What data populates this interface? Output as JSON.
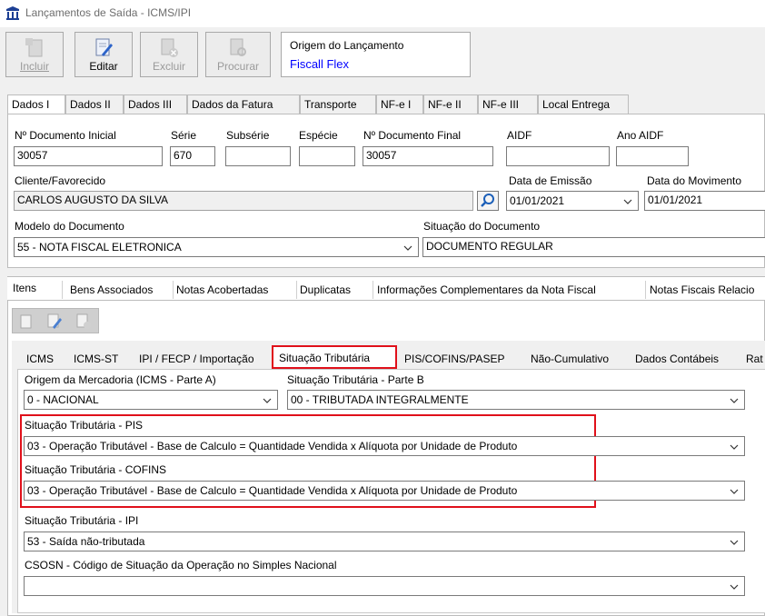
{
  "window": {
    "title": "Lançamentos de Saída - ICMS/IPI"
  },
  "toolbar": {
    "buttons": [
      {
        "label": "Incluir",
        "enabled": false
      },
      {
        "label": "Editar",
        "enabled": true
      },
      {
        "label": "Excluir",
        "enabled": false
      },
      {
        "label": "Procurar",
        "enabled": false
      }
    ],
    "origem_caption": "Origem do Lançamento",
    "origem_value": "Fiscall Flex"
  },
  "top_tabs": [
    "Dados I",
    "Dados II",
    "Dados III",
    "Dados da Fatura",
    "Transporte",
    "NF-e I",
    "NF-e II",
    "NF-e III",
    "Local Entrega"
  ],
  "form": {
    "doc_inicial_label": "Nº Documento Inicial",
    "doc_inicial": "30057",
    "serie_label": "Série",
    "serie": "670",
    "subserie_label": "Subsérie",
    "subserie": "",
    "especie_label": "Espécie",
    "especie": "",
    "doc_final_label": "Nº Documento Final",
    "doc_final": "30057",
    "aidf_label": "AIDF",
    "aidf": "",
    "ano_aidf_label": "Ano AIDF",
    "ano_aidf": "",
    "cliente_label": "Cliente/Favorecido",
    "cliente": "CARLOS AUGUSTO DA SILVA",
    "data_emissao_label": "Data de Emissão",
    "data_emissao": "01/01/2021",
    "data_movimento_label": "Data do Movimento",
    "data_movimento": "01/01/2021",
    "modelo_label": "Modelo do Documento",
    "modelo": "55 - NOTA FISCAL ELETRONICA",
    "situacao_doc_label": "Situação do Documento",
    "situacao_doc": "DOCUMENTO REGULAR"
  },
  "mid_tabs": [
    "Itens",
    "Bens Associados",
    "Notas Acobertadas",
    "Duplicatas",
    "Informações Complementares da Nota Fiscal",
    "Notas Fiscais Relacio"
  ],
  "inner_tabs": [
    "ICMS",
    "ICMS-ST",
    "IPI / FECP / Importação",
    "Situação Tributária",
    "PIS/COFINS/PASEP",
    "Não-Cumulativo",
    "Dados Contábeis",
    "Rat"
  ],
  "tributos": {
    "origem_label": "Origem da Mercadoria (ICMS - Parte A)",
    "origem": "0 - NACIONAL",
    "parte_b_label": "Situação Tributária - Parte B",
    "parte_b": "00 - TRIBUTADA INTEGRALMENTE",
    "pis_label": "Situação Tributária - PIS",
    "pis": "03 - Operação Tributável - Base de Calculo = Quantidade Vendida x Alíquota por Unidade de Produto",
    "cofins_label": "Situação Tributária - COFINS",
    "cofins": "03 - Operação Tributável - Base de Calculo = Quantidade Vendida x Alíquota por Unidade de Produto",
    "ipi_label": "Situação Tributária - IPI",
    "ipi": "53 - Saída não-tributada",
    "csosn_label": "CSOSN - Código de Situação da Operação no Simples Nacional",
    "csosn": ""
  },
  "colors": {
    "highlight": "#e0101a",
    "link": "#0000ff"
  }
}
